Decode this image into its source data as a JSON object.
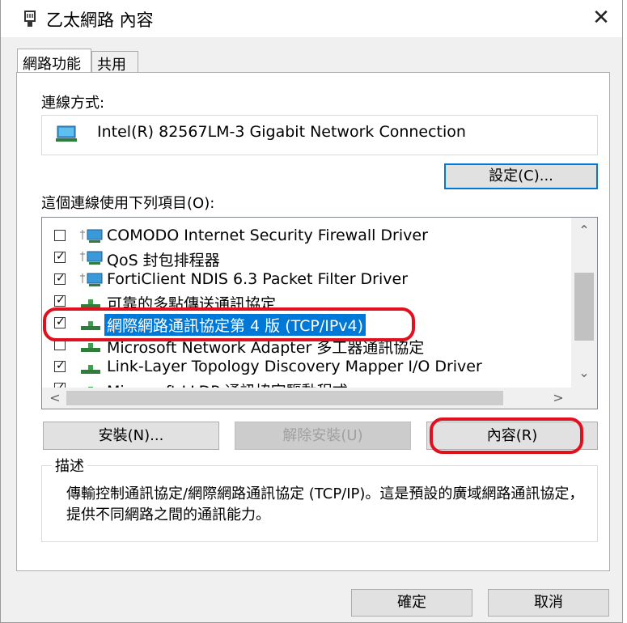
{
  "window": {
    "title": "乙太網路 內容",
    "close_symbol": "✕"
  },
  "tabs": [
    {
      "label": "網路功能",
      "active": true
    },
    {
      "label": "共用",
      "active": false
    }
  ],
  "connect_using": {
    "label": "連線方式:",
    "adapter_name": "Intel(R) 82567LM-3 Gigabit Network Connection"
  },
  "configure_button": {
    "label": "設定(C)..."
  },
  "items_label": "這個連線使用下列項目(O):",
  "items": [
    {
      "label": "COMODO Internet Security Firewall Driver",
      "checked": false,
      "icon": "network-client-icon"
    },
    {
      "label": "QoS 封包排程器",
      "checked": true,
      "icon": "network-client-icon"
    },
    {
      "label": "FortiClient NDIS 6.3 Packet Filter Driver",
      "checked": true,
      "icon": "network-client-icon"
    },
    {
      "label": "可靠的多點傳送通訊協定",
      "checked": true,
      "icon": "protocol-icon"
    },
    {
      "label": "網際網路通訊協定第 4 版 (TCP/IPv4)",
      "checked": true,
      "icon": "protocol-icon",
      "selected": true
    },
    {
      "label": "Microsoft Network Adapter 多工器通訊協定",
      "checked": false,
      "icon": "protocol-icon"
    },
    {
      "label": "Link-Layer Topology Discovery Mapper I/O Driver",
      "checked": true,
      "icon": "protocol-icon"
    },
    {
      "label": "Microsoft LLDP 通訊協定驅動程式",
      "checked": true,
      "icon": "protocol-icon"
    }
  ],
  "buttons": {
    "install": "安裝(N)...",
    "uninstall": "解除安裝(U)",
    "properties": "內容(R)"
  },
  "description": {
    "title": "描述",
    "text": "傳輸控制通訊協定/網際網路通訊協定 (TCP/IP)。這是預設的廣域網路通訊協定，提供不同網路之間的通訊能力。"
  },
  "footer": {
    "ok": "確定",
    "cancel": "取消"
  },
  "colors": {
    "selection": "#0078d7",
    "highlight_outline": "#e0101f",
    "focus_border": "#0078d7"
  }
}
